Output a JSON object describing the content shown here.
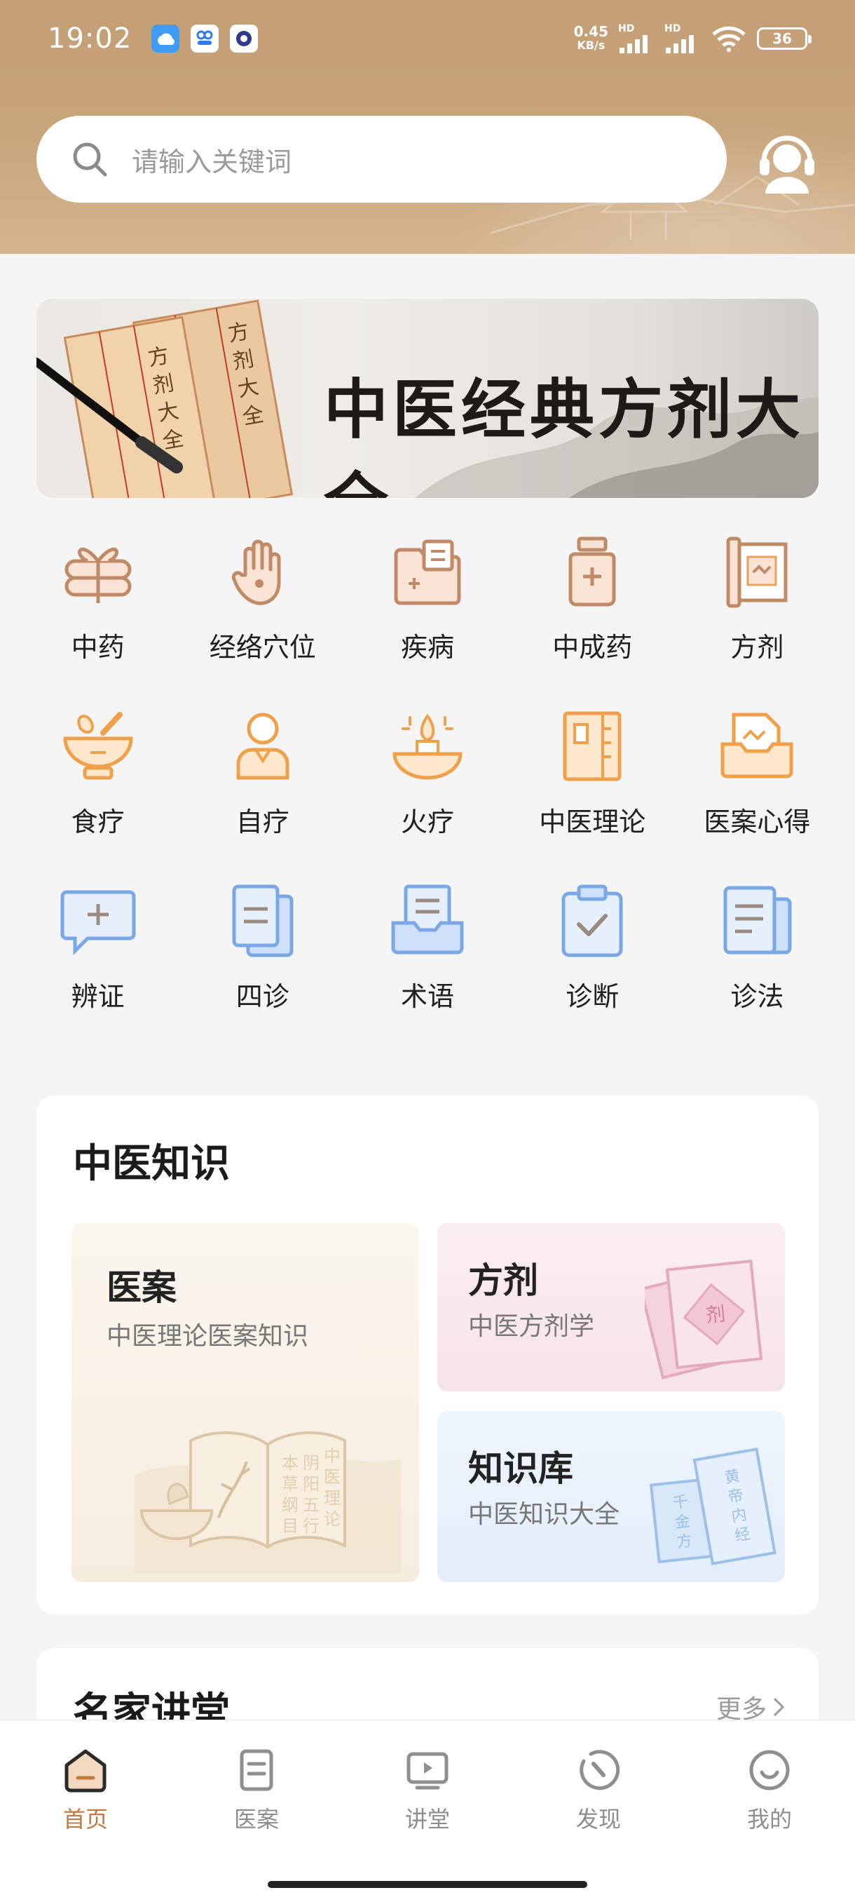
{
  "status_bar": {
    "time": "19:02",
    "net_speed_value": "0.45",
    "net_speed_unit": "KB/s",
    "signal_tag_1": "HD",
    "signal_tag_2": "HD",
    "battery": "36"
  },
  "search": {
    "placeholder": "请输入关键词"
  },
  "banner": {
    "title": "中医经典方剂大全"
  },
  "categories": [
    {
      "label": "中药",
      "icon": "gift-herb-icon"
    },
    {
      "label": "经络穴位",
      "icon": "hand-acupoint-icon"
    },
    {
      "label": "疾病",
      "icon": "folder-medical-icon"
    },
    {
      "label": "中成药",
      "icon": "medicine-jar-icon"
    },
    {
      "label": "方剂",
      "icon": "scroll-icon"
    },
    {
      "label": "食疗",
      "icon": "mortar-bowl-icon"
    },
    {
      "label": "自疗",
      "icon": "person-icon"
    },
    {
      "label": "火疗",
      "icon": "flame-bowl-icon"
    },
    {
      "label": "中医理论",
      "icon": "book-icon"
    },
    {
      "label": "医案心得",
      "icon": "folder-tray-icon"
    },
    {
      "label": "辨证",
      "icon": "chat-plus-icon"
    },
    {
      "label": "四诊",
      "icon": "document-stack-icon"
    },
    {
      "label": "术语",
      "icon": "inbox-document-icon"
    },
    {
      "label": "诊断",
      "icon": "clipboard-check-icon"
    },
    {
      "label": "诊法",
      "icon": "notes-icon"
    }
  ],
  "knowledge": {
    "title": "中医知识",
    "cards": {
      "yian": {
        "title": "医案",
        "subtitle": "中医理论医案知识"
      },
      "fangji": {
        "title": "方剂",
        "subtitle": "中医方剂学",
        "stamp": "剂"
      },
      "zhishiku": {
        "title": "知识库",
        "subtitle": "中医知识大全"
      }
    }
  },
  "lecture": {
    "title": "名家讲堂",
    "more": "更多"
  },
  "tabbar": {
    "tabs": [
      {
        "label": "首页",
        "icon": "home-icon",
        "active": true
      },
      {
        "label": "医案",
        "icon": "document-icon",
        "active": false
      },
      {
        "label": "讲堂",
        "icon": "play-screen-icon",
        "active": false
      },
      {
        "label": "发现",
        "icon": "compass-icon",
        "active": false
      },
      {
        "label": "我的",
        "icon": "smile-icon",
        "active": false
      }
    ]
  },
  "colors": {
    "header": "#c49e74",
    "accent": "#c47a3e",
    "icon_brown": "#c08a66",
    "icon_orange": "#f0a04a",
    "icon_blue": "#7aa8e6"
  }
}
